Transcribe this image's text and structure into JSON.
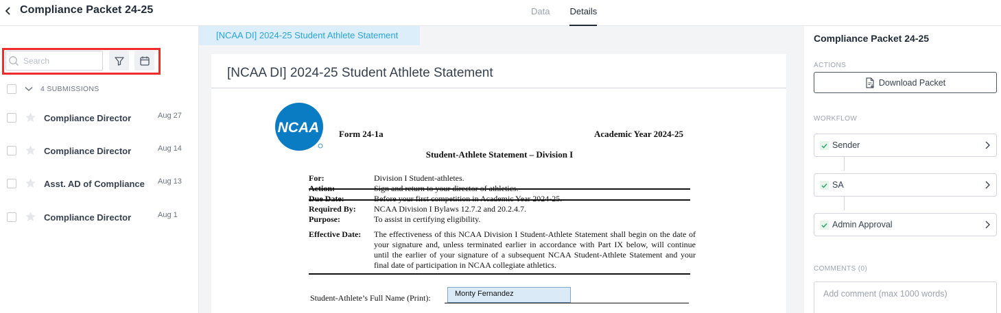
{
  "header": {
    "title": "Compliance Packet 24-25",
    "tabs": [
      {
        "label": "Data",
        "active": false
      },
      {
        "label": "Details",
        "active": true
      }
    ]
  },
  "sidebar": {
    "search": {
      "placeholder": "Search",
      "value": ""
    },
    "submissions_label": "4 SUBMISSIONS",
    "submissions": [
      {
        "name": "Compliance Director",
        "date": "Aug 27"
      },
      {
        "name": "Compliance Director",
        "date": "Aug 14"
      },
      {
        "name": "Asst. AD of Compliance",
        "date": "Aug 13"
      },
      {
        "name": "Compliance Director",
        "date": "Aug 1"
      }
    ]
  },
  "document": {
    "tab_label": "[NCAA DI] 2024-25 Student Athlete Statement",
    "title": "[NCAA DI] 2024-25 Student Athlete Statement",
    "form": {
      "logo_text": "NCAA",
      "form_number": "Form 24-1a",
      "academic_year": "Academic Year 2024-25",
      "heading": "Student-Athlete Statement – Division I",
      "fields": [
        {
          "label": "For:",
          "value": "Division I Student-athletes."
        },
        {
          "label": "Action:",
          "value": "Sign and return to your director of athletics."
        },
        {
          "label": "Due Date:",
          "value": "Before your first competition in Academic Year 2024-25."
        },
        {
          "label": "Required By:",
          "value": "NCAA Division I Bylaws 12.7.2 and 20.2.4.7."
        },
        {
          "label": "Purpose:",
          "value": "To assist in certifying eligibility."
        }
      ],
      "effective_label": "Effective Date:",
      "effective_text": "The effectiveness of this NCAA Division I Student-Athlete Statement shall begin on the date of your signature and, unless terminated earlier in accordance with Part IX below, will continue until the earlier of your signature of a subsequent NCAA Student-Athlete Statement and your final date of participation in NCAA collegiate athletics.",
      "name_label": "Student-Athlete’s Full Name (Print):",
      "name_value": "Monty Fernandez"
    }
  },
  "details": {
    "title": "Compliance Packet 24-25",
    "actions_label": "ACTIONS",
    "download_label": "Download Packet",
    "workflow_label": "WORKFLOW",
    "workflow": [
      {
        "label": "Sender",
        "done": true
      },
      {
        "label": "SA",
        "done": true
      },
      {
        "label": "Admin Approval",
        "done": true
      }
    ],
    "comments_label": "COMMENTS (0)",
    "comment_placeholder": "Add comment (max 1000 words)"
  },
  "colors": {
    "highlight": "#ef2b2b",
    "doc_tab_bg": "#dbeef9",
    "doc_tab_text": "#2ba3dc",
    "ncaa_blue": "#0a7cc4",
    "check_green": "#22a06b"
  }
}
